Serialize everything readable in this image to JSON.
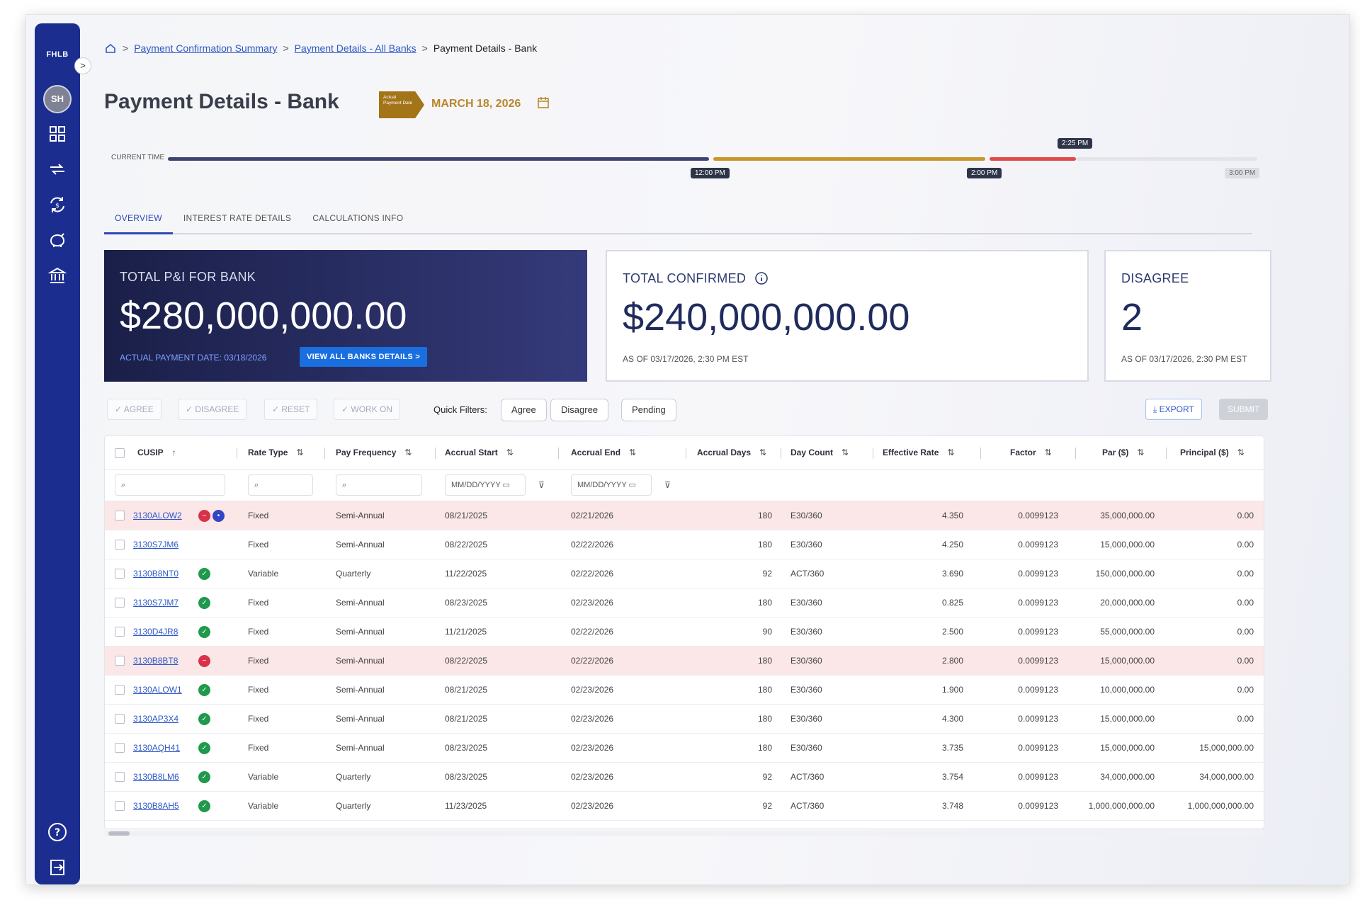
{
  "sidebar": {
    "logo": "FHLB",
    "toggle": ">",
    "avatar": "SH",
    "icons": [
      "dashboard-icon",
      "transfer-icon",
      "sync-icon",
      "savings-icon",
      "bank-icon"
    ],
    "bottom_icons": [
      "help-icon",
      "logout-icon"
    ]
  },
  "breadcrumb": {
    "home_icon": "home-icon",
    "items": [
      "Payment Confirmation Summary",
      "Payment Details - All Banks"
    ],
    "current": "Payment Details - Bank",
    "separator": ">"
  },
  "header": {
    "title": "Payment Details - Bank",
    "tag": "Actual Payment Date",
    "date": "MARCH 18, 2026"
  },
  "timeline": {
    "label": "CURRENT TIME",
    "marks": [
      "12:00 PM",
      "2:00 PM",
      "3:00 PM"
    ],
    "current": "2:25 PM",
    "colors": {
      "past": "#3d4470",
      "mid": "#c9962c",
      "now": "#e04a4a",
      "future": "#e3e4e8"
    }
  },
  "tabs": [
    "OVERVIEW",
    "INTEREST RATE DETAILS",
    "CALCULATIONS INFO"
  ],
  "cards": {
    "total": {
      "label": "TOTAL P&I FOR BANK",
      "value": "$280,000,000.00",
      "sub": "ACTUAL PAYMENT DATE: 03/18/2026",
      "button": "VIEW ALL BANKS DETAILS  >"
    },
    "confirmed": {
      "label": "TOTAL CONFIRMED",
      "value": "$240,000,000.00",
      "sub": "AS OF 03/17/2026, 2:30 PM EST"
    },
    "disagree": {
      "label": "DISAGREE",
      "value": "2",
      "sub": "AS OF 03/17/2026, 2:30 PM EST"
    }
  },
  "toolbar": {
    "agree": "AGREE",
    "disagree": "DISAGREE",
    "reset": "RESET",
    "work_on": "WORK ON",
    "quick_filters_label": "Quick Filters:",
    "quick_filters": [
      "Agree",
      "Disagree",
      "Pending"
    ],
    "export": "EXPORT",
    "submit": "SUBMIT"
  },
  "table": {
    "columns": [
      "CUSIP",
      "Rate Type",
      "Pay Frequency",
      "Accrual Start",
      "Accrual End",
      "Accrual Days",
      "Day Count",
      "Effective Rate",
      "Factor",
      "Par ($)",
      "Principal ($)"
    ],
    "filters": {
      "date_placeholder": "MM/DD/YYYY"
    },
    "rows": [
      {
        "cusip": "3130ALOW2",
        "status": "disagree-pending",
        "rate_type": "Fixed",
        "pay_freq": "Semi-Annual",
        "start": "08/21/2025",
        "end": "02/21/2026",
        "days": "180",
        "day_count": "E30/360",
        "rate": "4.350",
        "factor": "0.0099123",
        "par": "35,000,000.00",
        "principal": "0.00"
      },
      {
        "cusip": "3130S7JM6",
        "status": "none",
        "rate_type": "Fixed",
        "pay_freq": "Semi-Annual",
        "start": "08/22/2025",
        "end": "02/22/2026",
        "days": "180",
        "day_count": "E30/360",
        "rate": "4.250",
        "factor": "0.0099123",
        "par": "15,000,000.00",
        "principal": "0.00"
      },
      {
        "cusip": "3130B8NT0",
        "status": "agree",
        "rate_type": "Variable",
        "pay_freq": "Quarterly",
        "start": "11/22/2025",
        "end": "02/22/2026",
        "days": "92",
        "day_count": "ACT/360",
        "rate": "3.690",
        "factor": "0.0099123",
        "par": "150,000,000.00",
        "principal": "0.00"
      },
      {
        "cusip": "3130S7JM7",
        "status": "agree",
        "rate_type": "Fixed",
        "pay_freq": "Semi-Annual",
        "start": "08/23/2025",
        "end": "02/23/2026",
        "days": "180",
        "day_count": "E30/360",
        "rate": "0.825",
        "factor": "0.0099123",
        "par": "20,000,000.00",
        "principal": "0.00"
      },
      {
        "cusip": "3130D4JR8",
        "status": "agree",
        "rate_type": "Fixed",
        "pay_freq": "Semi-Annual",
        "start": "11/21/2025",
        "end": "02/22/2026",
        "days": "90",
        "day_count": "E30/360",
        "rate": "2.500",
        "factor": "0.0099123",
        "par": "55,000,000.00",
        "principal": "0.00"
      },
      {
        "cusip": "3130B8BT8",
        "status": "disagree",
        "rate_type": "Fixed",
        "pay_freq": "Semi-Annual",
        "start": "08/22/2025",
        "end": "02/22/2026",
        "days": "180",
        "day_count": "E30/360",
        "rate": "2.800",
        "factor": "0.0099123",
        "par": "15,000,000.00",
        "principal": "0.00"
      },
      {
        "cusip": "3130ALOW1",
        "status": "agree",
        "rate_type": "Fixed",
        "pay_freq": "Semi-Annual",
        "start": "08/21/2025",
        "end": "02/23/2026",
        "days": "180",
        "day_count": "E30/360",
        "rate": "1.900",
        "factor": "0.0099123",
        "par": "10,000,000.00",
        "principal": "0.00"
      },
      {
        "cusip": "3130AP3X4",
        "status": "agree",
        "rate_type": "Fixed",
        "pay_freq": "Semi-Annual",
        "start": "08/21/2025",
        "end": "02/23/2026",
        "days": "180",
        "day_count": "E30/360",
        "rate": "4.300",
        "factor": "0.0099123",
        "par": "15,000,000.00",
        "principal": "0.00"
      },
      {
        "cusip": "3130AQH41",
        "status": "agree",
        "rate_type": "Fixed",
        "pay_freq": "Semi-Annual",
        "start": "08/23/2025",
        "end": "02/23/2026",
        "days": "180",
        "day_count": "E30/360",
        "rate": "3.735",
        "factor": "0.0099123",
        "par": "15,000,000.00",
        "principal": "15,000,000.00"
      },
      {
        "cusip": "3130B8LM6",
        "status": "agree",
        "rate_type": "Variable",
        "pay_freq": "Quarterly",
        "start": "08/23/2025",
        "end": "02/23/2026",
        "days": "92",
        "day_count": "ACT/360",
        "rate": "3.754",
        "factor": "0.0099123",
        "par": "34,000,000.00",
        "principal": "34,000,000.00"
      },
      {
        "cusip": "3130B8AH5",
        "status": "agree",
        "rate_type": "Variable",
        "pay_freq": "Quarterly",
        "start": "11/23/2025",
        "end": "02/23/2026",
        "days": "92",
        "day_count": "ACT/360",
        "rate": "3.748",
        "factor": "0.0099123",
        "par": "1,000,000,000.00",
        "principal": "1,000,000,000.00"
      }
    ]
  }
}
